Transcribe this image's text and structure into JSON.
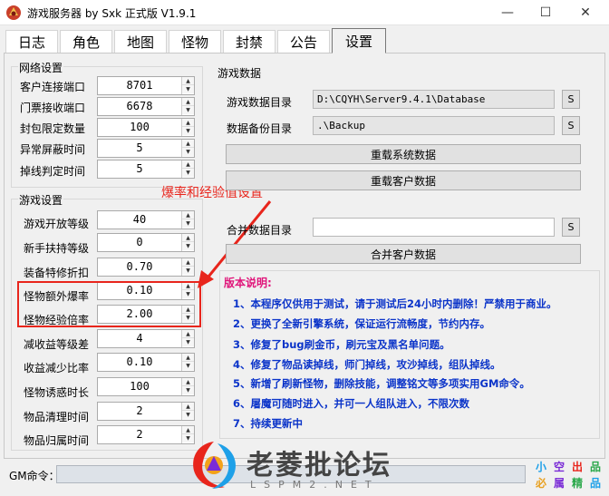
{
  "window": {
    "title": "游戏服务器 by Sxk 正式版 V1.9.1",
    "minimize_glyph": "—",
    "maximize_glyph": "☐",
    "close_glyph": "✕"
  },
  "tabs": [
    {
      "label": "日志"
    },
    {
      "label": "角色"
    },
    {
      "label": "地图"
    },
    {
      "label": "怪物"
    },
    {
      "label": "封禁"
    },
    {
      "label": "公告"
    },
    {
      "label": "设置"
    }
  ],
  "network": {
    "title": "网络设置",
    "fields": [
      {
        "label": "客户连接端口",
        "value": "8701"
      },
      {
        "label": "门票接收端口",
        "value": "6678"
      },
      {
        "label": "封包限定数量",
        "value": "100"
      },
      {
        "label": "异常屏蔽时间",
        "value": "5"
      },
      {
        "label": "掉线判定时间",
        "value": "5"
      }
    ]
  },
  "game": {
    "title": "游戏设置",
    "fields": [
      {
        "label": "游戏开放等级",
        "value": "40"
      },
      {
        "label": "新手扶持等级",
        "value": "0"
      },
      {
        "label": "装备特修折扣",
        "value": "0.70"
      },
      {
        "label": "怪物额外爆率",
        "value": "0.10"
      },
      {
        "label": "怪物经验倍率",
        "value": "2.00"
      },
      {
        "label": "减收益等级差",
        "value": "4"
      },
      {
        "label": "收益减少比率",
        "value": "0.10"
      },
      {
        "label": "怪物诱惑时长",
        "value": "100"
      },
      {
        "label": "物品清理时间",
        "value": "2"
      },
      {
        "label": "物品归属时间",
        "value": "2"
      }
    ]
  },
  "gamedata": {
    "title": "游戏数据",
    "data_dir_label": "游戏数据目录",
    "data_dir_value": "D:\\CQYH\\Server9.4.1\\Database",
    "backup_dir_label": "数据备份目录",
    "backup_dir_value": ".\\Backup",
    "browse_label": "S",
    "reload_system_label": "重载系统数据",
    "reload_client_label": "重载客户数据",
    "merge_dir_label": "合并数据目录",
    "merge_dir_value": "",
    "merge_client_label": "合并客户数据"
  },
  "annotation": {
    "text": "爆率和经验值设置"
  },
  "notes": {
    "title": "版本说明:",
    "lines": [
      "1、本程序仅供用于测试，请于测试后24小时内删除！严禁用于商业。",
      "2、更换了全新引擎系统，保证运行流畅度，节约内存。",
      "3、修复了bug刷金币，刷元宝及黑名单问题。",
      "4、修复了物品读掉线，师门掉线，攻沙掉线，组队掉线。",
      "5、新增了刷新怪物，删除技能，调整铭文等多项实用GM命令。",
      "6、屠魔可随时进入，并可一人组队进入，不限次数",
      "7、持续更新中"
    ]
  },
  "gm": {
    "label": "GM命令：",
    "value": ""
  },
  "watermark": {
    "brand": "老菱批论坛",
    "sub": "LSPM2.NET",
    "chars": [
      "小",
      "空",
      "出",
      "品",
      "必",
      "属",
      "精",
      "品"
    ],
    "colors": [
      "#1ea0e8",
      "#7a2bd6",
      "#e8251c",
      "#2aa84a",
      "#e8a020",
      "#7a2bd6",
      "#2aa84a",
      "#1ea0e8"
    ]
  },
  "colors": {
    "annotation_red": "#e8251c",
    "notes_title": "#e0157a",
    "notes_text": "#0b34c9"
  }
}
